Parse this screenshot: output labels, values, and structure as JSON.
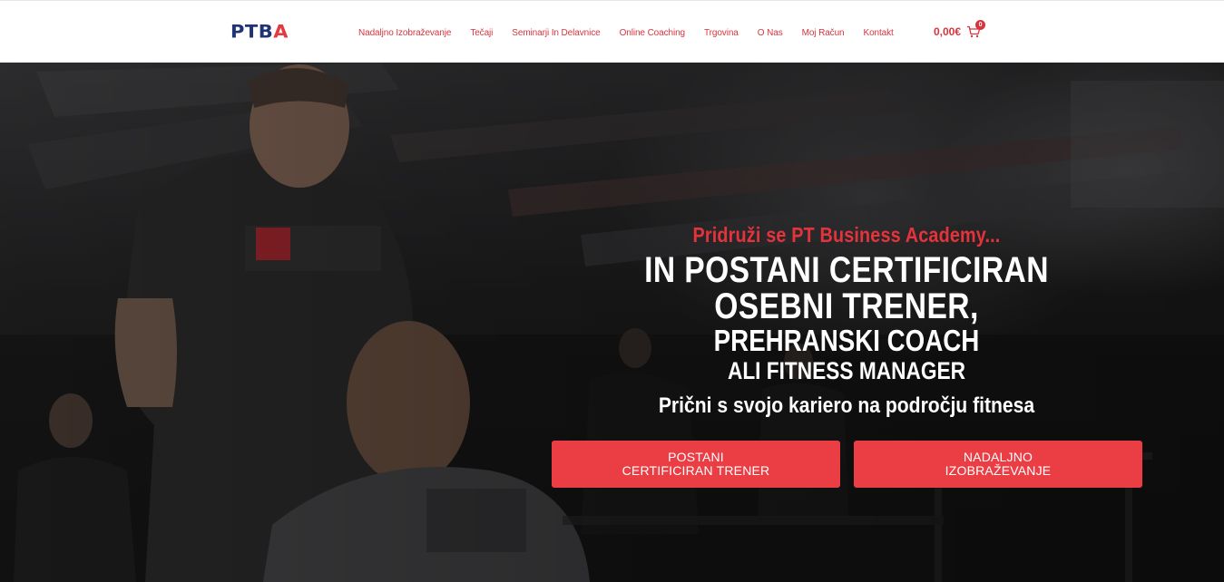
{
  "header": {
    "logo": {
      "p": "PT",
      "b": "B",
      "a": "A"
    },
    "nav": [
      "Nadaljno Izobraževanje",
      "Tečaji",
      "Seminarji In Delavnice",
      "Online Coaching",
      "Trgovina",
      "O Nas",
      "Moj Račun",
      "Kontakt"
    ],
    "cart": {
      "total": "0,00€",
      "count": "0",
      "icon": "shopping-cart-icon"
    }
  },
  "hero": {
    "pre_title": "Pridruži se PT Business Academy...",
    "line1": "IN POSTANI CERTIFICIRAN",
    "line2": "OSEBNI TRENER,",
    "line3": "PREHRANSKI COACH",
    "line4": "ALI FITNESS MANAGER",
    "subtitle": "Prični s svojo kariero na področju fitnesa",
    "buttons": [
      {
        "line1": "POSTANI",
        "line2": "CERTIFICIRAN TRENER"
      },
      {
        "line1": "NADALJNO",
        "line2": "IZOBRAŽEVANJE"
      }
    ]
  },
  "colors": {
    "brand_red": "#e33a42",
    "brand_blue": "#213377",
    "button_red": "#ea3d44"
  }
}
